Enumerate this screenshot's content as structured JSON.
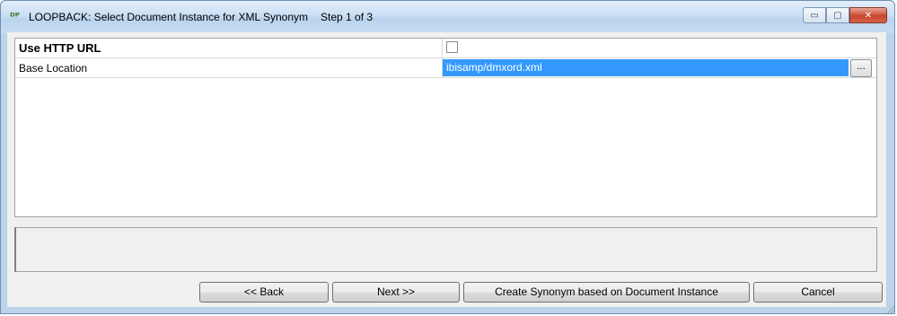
{
  "window": {
    "title": "LOOPBACK: Select Document Instance for XML Synonym",
    "step": "Step 1 of 3",
    "icon": "app-icon",
    "controls": {
      "minimize": "▭",
      "maximize": "▢",
      "close": "✕"
    }
  },
  "properties": [
    {
      "label": "Use HTTP URL",
      "type": "checkbox",
      "checked": false
    },
    {
      "label": "Base Location",
      "type": "text",
      "value": "ibisamp/dmxord.xml",
      "browse_label": "..."
    }
  ],
  "buttons": {
    "back": "<< Back",
    "next": "Next >>",
    "create": "Create Synonym based on Document Instance",
    "cancel": "Cancel"
  },
  "colors": {
    "selection": "#3399ff",
    "close_button": "#c8462e"
  }
}
